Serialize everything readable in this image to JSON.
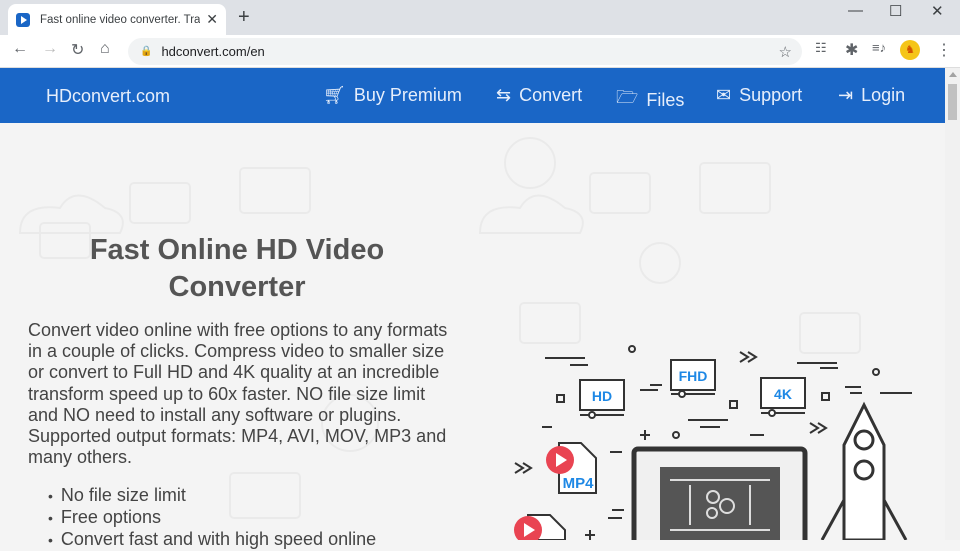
{
  "browser": {
    "tab_title": "Fast online video converter. Transform",
    "tab_close": "✕",
    "new_tab": "+",
    "url": "hdconvert.com/en",
    "window_controls": {
      "minimize": "—",
      "maximize": "☐",
      "close": "✕"
    }
  },
  "nav": {
    "brand": "HDconvert.com",
    "items": [
      {
        "label": "Buy Premium",
        "icon": "cart-icon"
      },
      {
        "label": "Convert",
        "icon": "convert-arrows-icon"
      },
      {
        "label": "Files",
        "icon": "folder-icon"
      },
      {
        "label": "Support",
        "icon": "envelope-icon"
      },
      {
        "label": "Login",
        "icon": "login-icon"
      }
    ]
  },
  "hero": {
    "title": "Fast Online HD Video Converter",
    "description": "Convert video online with free options to any formats in a couple of clicks. Compress video to smaller size or convert to Full HD and 4K quality at an incredible transform speed up to 60x faster. NO file size limit and NO need to install any software or plugins. Supported output formats: MP4, AVI, MOV, MP3 and many others.",
    "bullets": [
      "No file size limit",
      "Free options",
      "Convert fast and with high speed online"
    ]
  },
  "illustration": {
    "labels": {
      "hd": "HD",
      "fhd": "FHD",
      "k4": "4K",
      "mp4": "MP4"
    }
  },
  "colors": {
    "brand": "#1a66c6",
    "play": "#e94452",
    "label": "#1e88e5"
  }
}
